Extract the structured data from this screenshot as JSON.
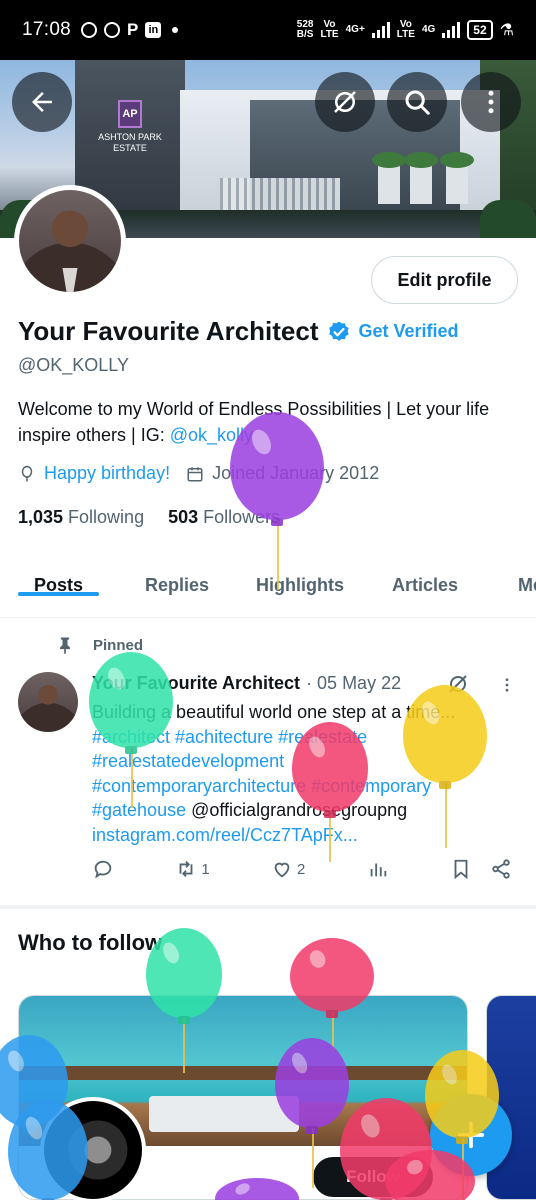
{
  "status_bar": {
    "time": "17:08",
    "speed_value": "528",
    "speed_unit": "B/S",
    "sim1_top": "Vo",
    "sim1_bottom": "LTE",
    "net1": "4G+",
    "sim2_top": "Vo",
    "sim2_bottom": "LTE",
    "net2": "4G",
    "battery": "52"
  },
  "banner": {
    "estate_logo": "AP",
    "estate_name_line1": "ASHTON PARK",
    "estate_name_line2": "ESTATE"
  },
  "header": {
    "back_icon": "arrow-left-icon",
    "grok_icon": "grok-icon",
    "search_icon": "search-icon",
    "more_icon": "more-vertical-icon"
  },
  "profile": {
    "edit_label": "Edit profile",
    "name": "Your Favourite Architect",
    "get_verified": "Get Verified",
    "handle": "@OK_KOLLY",
    "bio_text": "Welcome to my World of Endless Possibilities | Let your life inspire others  |  IG: ",
    "bio_link": "@ok_kolly",
    "birthday": "Happy birthday!",
    "joined": "Joined January 2012",
    "following_count": "1,035",
    "following_label": "Following",
    "followers_count": "503",
    "followers_label": "Followers"
  },
  "tabs": [
    "Posts",
    "Replies",
    "Highlights",
    "Articles",
    "Media"
  ],
  "pinned_tweet": {
    "pinned_label": "Pinned",
    "author": "Your Favourite Architect",
    "date": "· 05 May 22",
    "text_plain": "Building a beautiful world one step at a time...",
    "hashtags_1": "#architect #achitecture #realestate",
    "hashtags_2": "#realestatedevelopment",
    "hashtags_3": "#contemporaryarchitecture #contemporary",
    "hashtag_4": "#gatehouse",
    "mention": " @officialgrandrosegroupng",
    "link": "instagram.com/reel/Ccz7TApFx...",
    "retweets": "1",
    "likes": "2"
  },
  "who_to_follow": {
    "title": "Who to follow",
    "follow_label": "Follow"
  },
  "colors": {
    "accent": "#1d9bf0",
    "text": "#0f1419",
    "muted": "#536471"
  }
}
